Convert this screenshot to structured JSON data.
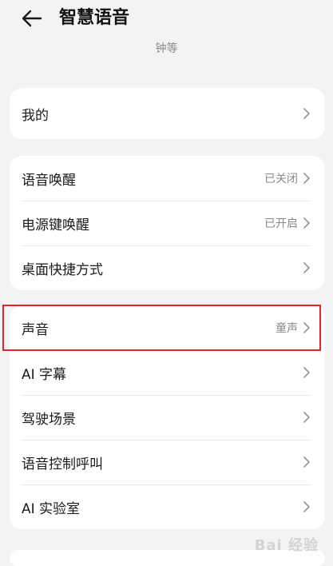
{
  "header": {
    "title": "智慧语音",
    "subtitle": "钟等"
  },
  "group1": {
    "items": [
      {
        "label": "我的",
        "value": ""
      }
    ]
  },
  "group2": {
    "items": [
      {
        "label": "语音唤醒",
        "value": "已关闭"
      },
      {
        "label": "电源键唤醒",
        "value": "已开启"
      },
      {
        "label": "桌面快捷方式",
        "value": ""
      }
    ]
  },
  "group3": {
    "items": [
      {
        "label": "声音",
        "value": "童声"
      },
      {
        "label": "AI 字幕",
        "value": ""
      },
      {
        "label": "驾驶场景",
        "value": ""
      },
      {
        "label": "语音控制呼叫",
        "value": ""
      },
      {
        "label": "AI 实验室",
        "value": ""
      }
    ]
  },
  "watermark": "Bai 经验",
  "colors": {
    "background": "#f1f3f5",
    "card": "#ffffff",
    "highlight": "#e0252d",
    "secondary_text": "#8a8a8a"
  },
  "icons": {
    "back": "arrow-left-icon",
    "row_chevron": "chevron-right-icon"
  }
}
